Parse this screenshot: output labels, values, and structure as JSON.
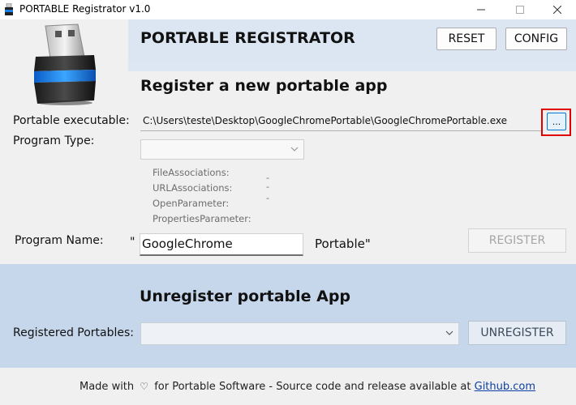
{
  "window": {
    "title": "PORTABLE Registrator v1.0"
  },
  "header": {
    "title": "PORTABLE REGISTRATOR",
    "reset_label": "RESET",
    "config_label": "CONFIG"
  },
  "register": {
    "section_title": "Register a new portable app",
    "exe_label": "Portable executable:",
    "exe_path": "C:\\Users\\teste\\Desktop\\GoogleChromePortable\\GoogleChromePortable.exe",
    "browse_label": "...",
    "type_label": "Program Type:",
    "info": [
      {
        "label": "FileAssociations:",
        "value": "-"
      },
      {
        "label": "URLAssociations:",
        "value": "-"
      },
      {
        "label": "OpenParameter:",
        "value": "-"
      },
      {
        "label": "PropertiesParameter:",
        "value": ""
      }
    ],
    "name_label": "Program Name:",
    "quote_open": "\"",
    "name_value": "GoogleChrome",
    "portable_suffix": "Portable\"",
    "register_label": "REGISTER"
  },
  "unregister": {
    "section_title": "Unregister portable App",
    "registered_label": "Registered Portables:",
    "unregister_label": "UNREGISTER"
  },
  "footer": {
    "made_with": "Made with",
    "rest": "for Portable Software - Source code and release available at",
    "link": "Github.com"
  },
  "colors": {
    "header_band": "#dce6f2",
    "unregister_band": "#c6d7ec",
    "highlight": "#e00000",
    "link": "#0b3fa6"
  }
}
